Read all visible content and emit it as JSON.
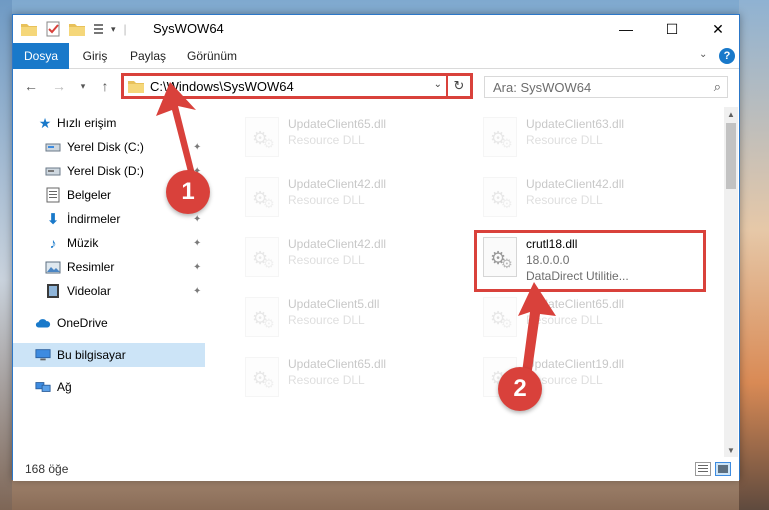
{
  "window": {
    "title": "SysWOW64",
    "controls": {
      "minimize": "—",
      "maximize": "☐",
      "close": "✕"
    }
  },
  "ribbon": {
    "tabs": [
      "Dosya",
      "Giriş",
      "Paylaş",
      "Görünüm"
    ],
    "active_tab": "Dosya"
  },
  "address": {
    "path": "C:\\Windows\\SysWOW64",
    "search_placeholder": "Ara: SysWOW64"
  },
  "sidebar": {
    "quick_access": "Hızlı erişim",
    "items": [
      {
        "label": "Yerel Disk (C:)",
        "icon": "drive-icon",
        "pinned": true
      },
      {
        "label": "Yerel Disk (D:)",
        "icon": "drive-icon",
        "pinned": true
      },
      {
        "label": "Belgeler",
        "icon": "documents-icon",
        "pinned": true
      },
      {
        "label": "İndirmeler",
        "icon": "downloads-icon",
        "pinned": true
      },
      {
        "label": "Müzik",
        "icon": "music-icon",
        "pinned": true
      },
      {
        "label": "Resimler",
        "icon": "pictures-icon",
        "pinned": true
      },
      {
        "label": "Videolar",
        "icon": "videos-icon",
        "pinned": true
      }
    ],
    "onedrive": "OneDrive",
    "this_pc": "Bu bilgisayar",
    "network": "Ağ"
  },
  "files": {
    "left": [
      {
        "name": "UpdateClient65.dll",
        "desc": "Resource DLL"
      },
      {
        "name": "UpdateClient42.dll",
        "desc": "Resource DLL"
      },
      {
        "name": "UpdateClient42.dll",
        "desc": "Resource DLL"
      },
      {
        "name": "UpdateClient5.dll",
        "desc": "Resource DLL"
      },
      {
        "name": "UpdateClient65.dll",
        "desc": "Resource DLL"
      }
    ],
    "right": [
      {
        "name": "UpdateClient63.dll",
        "desc": "Resource DLL"
      },
      {
        "name": "UpdateClient42.dll",
        "desc": "Resource DLL"
      },
      {
        "name": "UpdateClient65.dll",
        "desc": "Resource DLL"
      },
      {
        "name": "UpdateClient19.dll",
        "desc": "Resource DLL"
      }
    ],
    "highlighted": {
      "name": "crutl18.dll",
      "version": "18.0.0.0",
      "company": "DataDirect Utilitie..."
    }
  },
  "status": {
    "item_count": "168 öğe"
  },
  "annotations": {
    "step1": "1",
    "step2": "2"
  },
  "colors": {
    "accent": "#1979ca",
    "highlight": "#d9413b"
  }
}
